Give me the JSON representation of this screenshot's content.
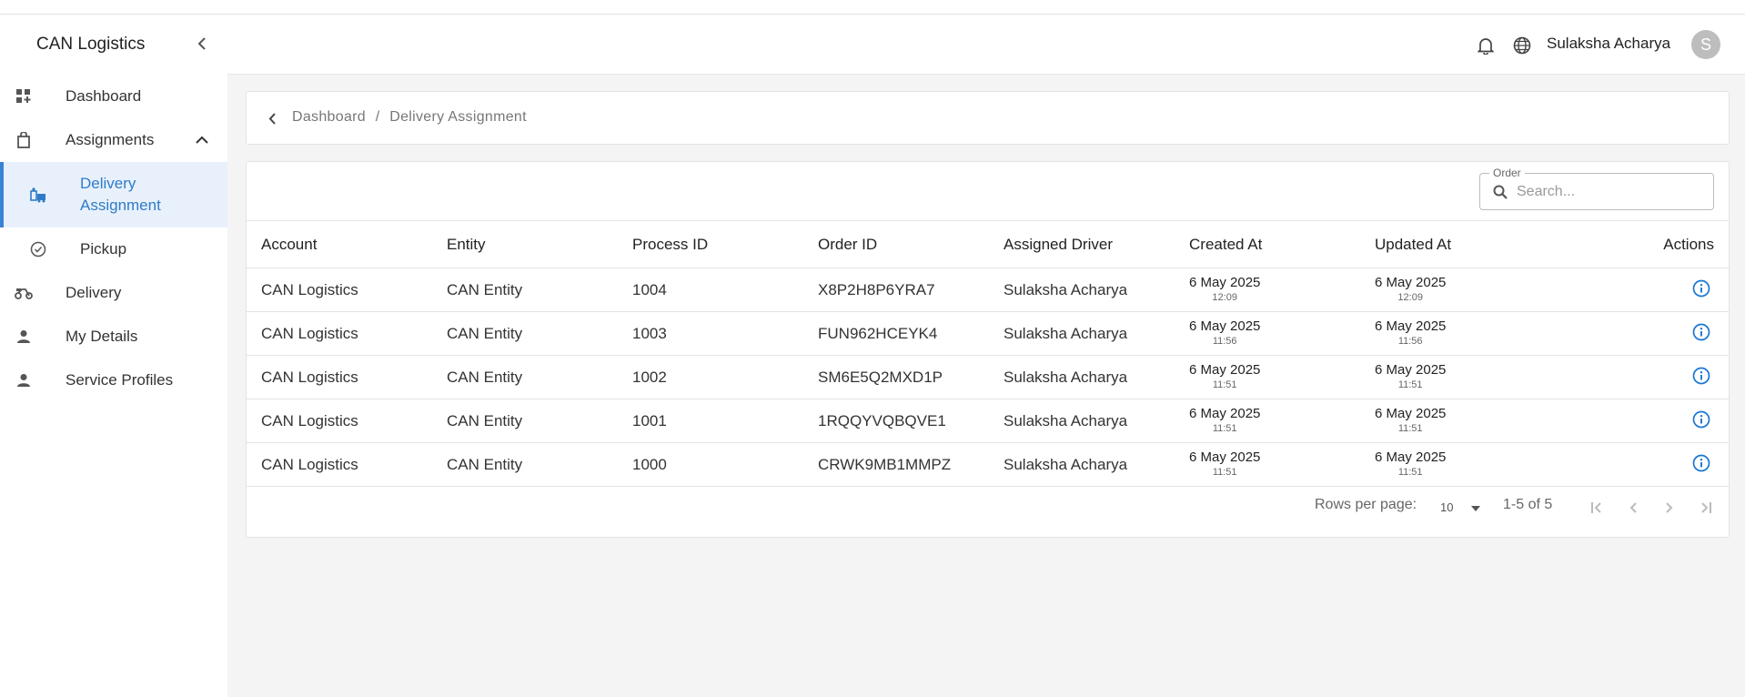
{
  "app": {
    "brand": "CAN Logistics"
  },
  "header": {
    "user_name": "Sulaksha Acharya",
    "avatar_initial": "S"
  },
  "sidebar": {
    "items": [
      {
        "label": "Dashboard",
        "icon": "dashboard-icon"
      },
      {
        "label": "Assignments",
        "icon": "shopping-bag-icon"
      },
      {
        "label": "Delivery Assignment",
        "icon": "delivery-assignment-icon",
        "active": true
      },
      {
        "label": "Pickup",
        "icon": "check-circle-icon"
      },
      {
        "label": "Delivery",
        "icon": "scooter-icon"
      },
      {
        "label": "My Details",
        "icon": "person-icon"
      },
      {
        "label": "Service Profiles",
        "icon": "person-icon"
      }
    ]
  },
  "breadcrumb": {
    "root": "Dashboard",
    "separator": "/",
    "current": "Delivery Assignment"
  },
  "search": {
    "legend": "Order",
    "placeholder": "Search..."
  },
  "table": {
    "headers": [
      "Account",
      "Entity",
      "Process ID",
      "Order ID",
      "Assigned Driver",
      "Created At",
      "Updated At",
      "Actions"
    ],
    "rows": [
      {
        "account": "CAN Logistics",
        "entity": "CAN Entity",
        "process_id": "1004",
        "order_id": "X8P2H8P6YRA7",
        "driver": "Sulaksha Acharya",
        "created_date": "6 May 2025",
        "created_time": "12:09",
        "updated_date": "6 May 2025",
        "updated_time": "12:09"
      },
      {
        "account": "CAN Logistics",
        "entity": "CAN Entity",
        "process_id": "1003",
        "order_id": "FUN962HCEYK4",
        "driver": "Sulaksha Acharya",
        "created_date": "6 May 2025",
        "created_time": "11:56",
        "updated_date": "6 May 2025",
        "updated_time": "11:56"
      },
      {
        "account": "CAN Logistics",
        "entity": "CAN Entity",
        "process_id": "1002",
        "order_id": "SM6E5Q2MXD1P",
        "driver": "Sulaksha Acharya",
        "created_date": "6 May 2025",
        "created_time": "11:51",
        "updated_date": "6 May 2025",
        "updated_time": "11:51"
      },
      {
        "account": "CAN Logistics",
        "entity": "CAN Entity",
        "process_id": "1001",
        "order_id": "1RQQYVQBQVE1",
        "driver": "Sulaksha Acharya",
        "created_date": "6 May 2025",
        "created_time": "11:51",
        "updated_date": "6 May 2025",
        "updated_time": "11:51"
      },
      {
        "account": "CAN Logistics",
        "entity": "CAN Entity",
        "process_id": "1000",
        "order_id": "CRWK9MB1MMPZ",
        "driver": "Sulaksha Acharya",
        "created_date": "6 May 2025",
        "created_time": "11:51",
        "updated_date": "6 May 2025",
        "updated_time": "11:51"
      }
    ]
  },
  "pagination": {
    "rows_per_page_label": "Rows per page:",
    "rows_per_page": "10",
    "range": "1-5 of 5"
  },
  "colors": {
    "accent": "#2f7bc9",
    "active_bg": "#e8f1fb",
    "info_icon": "#1976d2"
  }
}
